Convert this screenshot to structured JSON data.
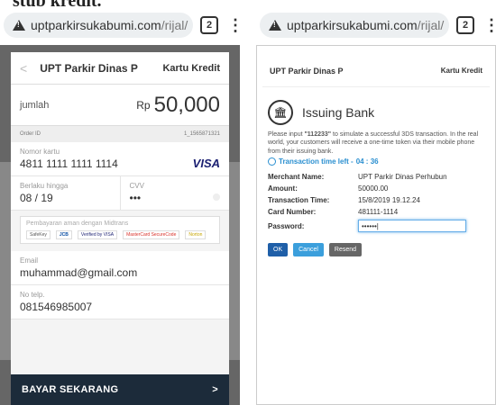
{
  "caption": "stub kredit.",
  "left_phone": {
    "url_host": "uptparkirsukabumi.com",
    "url_path": "/rijal/",
    "tab_count": "2",
    "merchant": "UPT Parkir Dinas P",
    "payment_type": "Kartu Kredit",
    "amount_label": "jumlah",
    "currency": "Rp",
    "amount": "50,000",
    "order_label": "Order ID",
    "order_id": "1_1565871321",
    "card_number_label": "Nomor kartu",
    "card_number": "4811 1111 1111 1114",
    "card_brand": "VISA",
    "expiry_label": "Berlaku hingga",
    "expiry": "08 / 19",
    "cvv_label": "CVV",
    "cvv": "•••",
    "secure_text": "Pembayaran aman dengan Midtrans",
    "logos": [
      "SafeKey",
      "JCB",
      "Verified by VISA",
      "MasterCard SecureCode",
      "Norton"
    ],
    "email_label": "Email",
    "email": "muhammad@gmail.com",
    "phone_label": "No telp.",
    "phone": "081546985007",
    "pay_button": "BAYAR SEKARANG"
  },
  "right_phone": {
    "url_host": "uptparkirsukabumi.com",
    "url_path": "/rijal/",
    "tab_count": "2",
    "merchant": "UPT Parkir Dinas P",
    "payment_type": "Kartu Kredit",
    "title": "Issuing Bank",
    "desc_before": "Please input ",
    "otp": "\"112233\"",
    "desc_after": " to simulate a successful 3DS transaction. In the real world, your customers will receive a one-time token via their mobile phone from their issuing bank.",
    "timer_label": "Transaction time left - ",
    "timer_value": "04 : 36",
    "rows": [
      {
        "k": "Merchant Name:",
        "v": "UPT Parkir Dinas Perhubun"
      },
      {
        "k": "Amount:",
        "v": "50000.00"
      },
      {
        "k": "Transaction Time:",
        "v": "15/8/2019 19.12.24"
      },
      {
        "k": "Card Number:",
        "v": "481111-1114"
      }
    ],
    "password_label": "Password:",
    "password_value": "••••••|",
    "btn_ok": "OK",
    "btn_cancel": "Cancel",
    "btn_resend": "Resend"
  }
}
